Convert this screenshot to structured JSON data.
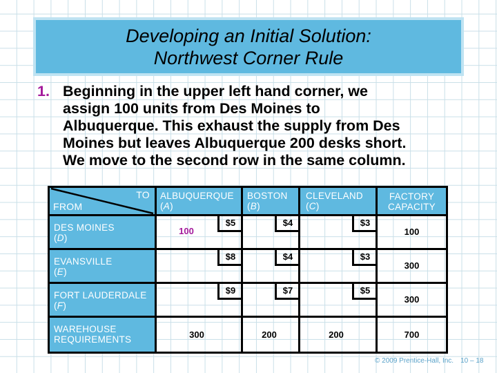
{
  "slide": {
    "title_lines": [
      "Developing an Initial Solution:",
      "Northwest Corner Rule"
    ],
    "step_number": "1.",
    "step_lines": [
      "Beginning in the upper left hand corner, we",
      "assign 100 units from Des Moines to",
      "Albuquerque. This exhaust the supply from Des",
      "Moines but leaves Albuquerque 200 desks short.",
      "We move to the second row in the same column."
    ],
    "colors": {
      "header_fill": "#5fb9e0",
      "accent": "#a3199b",
      "grid": "#c9dfe8"
    }
  },
  "table": {
    "corner": {
      "to": "TO",
      "from": "FROM"
    },
    "columns": [
      {
        "name": "ALBUQUERQUE",
        "code": "A"
      },
      {
        "name": "BOSTON",
        "code": "B"
      },
      {
        "name": "CLEVELAND",
        "code": "C"
      }
    ],
    "capacity_header": [
      "FACTORY",
      "CAPACITY"
    ],
    "rows": [
      {
        "name": "DES MOINES",
        "code": "D",
        "costs": [
          "$5",
          "$4",
          "$3"
        ],
        "allocations": [
          "100",
          "",
          ""
        ],
        "capacity": "100"
      },
      {
        "name": "EVANSVILLE",
        "code": "E",
        "costs": [
          "$8",
          "$4",
          "$3"
        ],
        "allocations": [
          "",
          "",
          ""
        ],
        "capacity": "300"
      },
      {
        "name": "FORT LAUDERDALE",
        "code": "F",
        "costs": [
          "$9",
          "$7",
          "$5"
        ],
        "allocations": [
          "",
          "",
          ""
        ],
        "capacity": "300"
      }
    ],
    "requirements": {
      "label": [
        "WAREHOUSE",
        "REQUIREMENTS"
      ],
      "values": [
        "300",
        "200",
        "200"
      ],
      "total": "700"
    }
  },
  "footer": {
    "copyright": "© 2009 Prentice-Hall, Inc.",
    "page": "10 – 18"
  }
}
